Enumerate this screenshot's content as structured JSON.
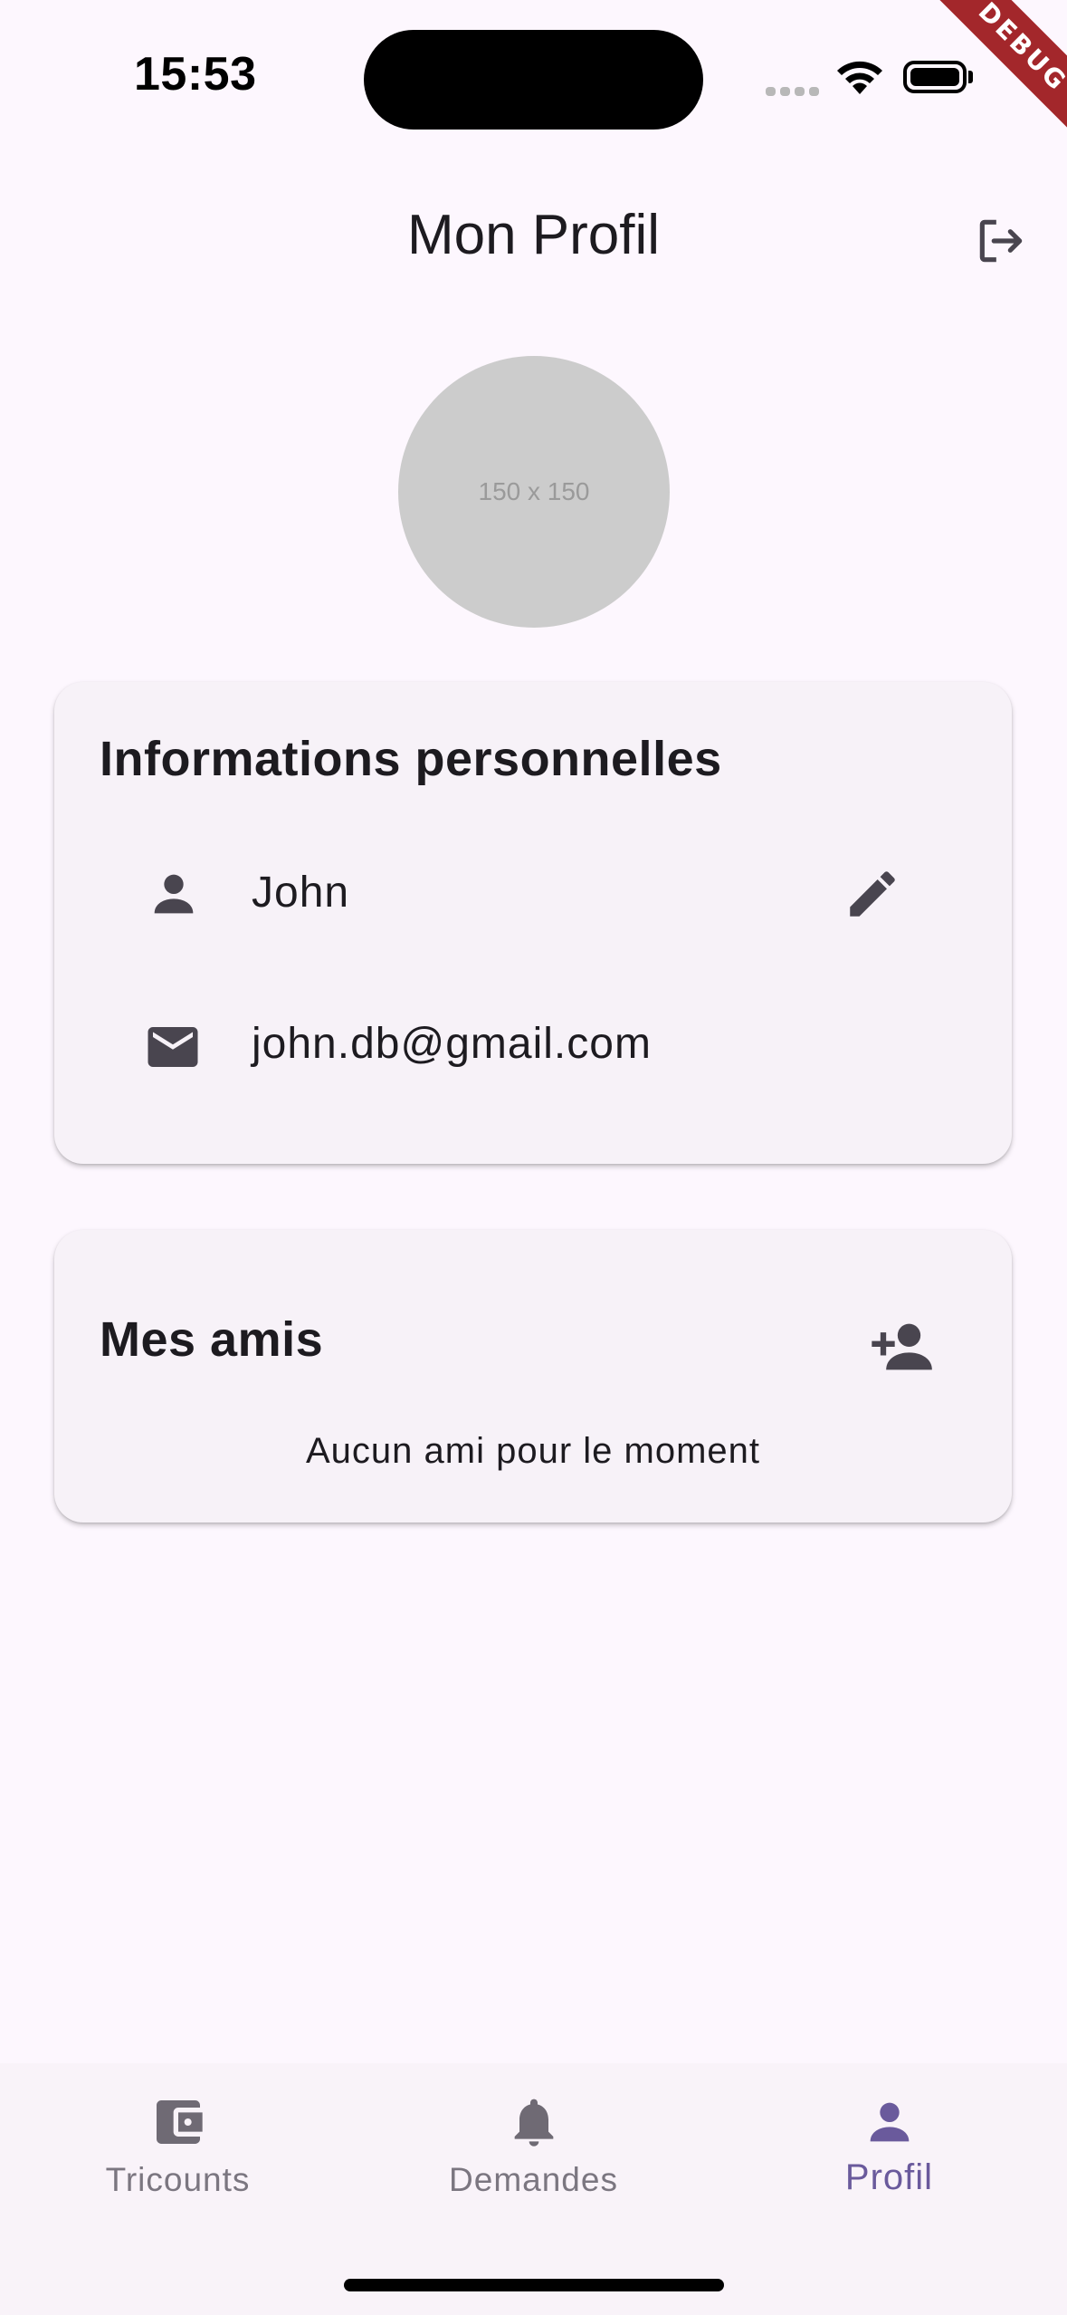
{
  "status_bar": {
    "time": "15:53"
  },
  "debug_banner": "DEBUG",
  "app_bar": {
    "title": "Mon Profil",
    "logout_icon": "logout-icon"
  },
  "avatar": {
    "placeholder_text": "150 x 150"
  },
  "personal_info": {
    "title": "Informations personnelles",
    "name": "John",
    "email": "john.db@gmail.com",
    "name_icon": "person-icon",
    "email_icon": "mail-icon",
    "edit_icon": "edit-icon"
  },
  "friends": {
    "title": "Mes amis",
    "empty_message": "Aucun ami pour le moment",
    "add_icon": "person-add-icon"
  },
  "bottom_nav": {
    "items": [
      {
        "label": "Tricounts",
        "icon": "wallet-icon",
        "active": false
      },
      {
        "label": "Demandes",
        "icon": "bell-icon",
        "active": false
      },
      {
        "label": "Profil",
        "icon": "person-icon",
        "active": true
      }
    ]
  },
  "colors": {
    "background": "#fdf7fe",
    "card": "#f7f2f8",
    "accent": "#6a5a9c",
    "icon": "#49454f",
    "inactive_nav": "#7b7680",
    "debug_ribbon": "#a3272b"
  }
}
